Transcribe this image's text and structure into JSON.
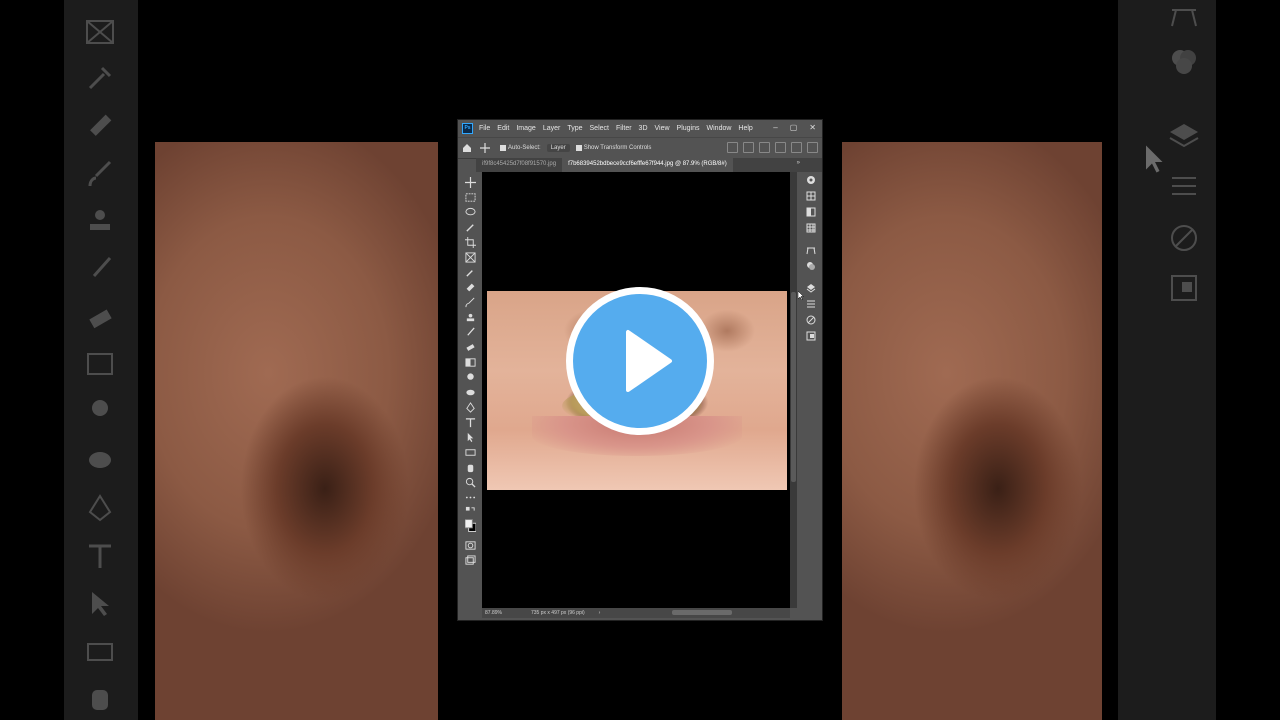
{
  "menu": {
    "app_logo": "Ps",
    "items": [
      "File",
      "Edit",
      "Image",
      "Layer",
      "Type",
      "Select",
      "Filter",
      "3D",
      "View",
      "Plugins",
      "Window",
      "Help"
    ],
    "window_controls": [
      "–",
      "▢",
      "✕"
    ]
  },
  "options": {
    "auto_select_label": "Auto-Select:",
    "auto_select_value": "Layer",
    "show_transform_label": "Show Transform Controls"
  },
  "tabs": [
    {
      "label": "if9f8c45425d7f08f91570.jpg",
      "active": false
    },
    {
      "label": "f7b6839452bdbece9ccf6efffe67f944.jpg @ 87.9% (RGB/8#)",
      "active": true
    }
  ],
  "tabs_more": "»",
  "status": {
    "zoom": "87.89%",
    "dimensions": "735 px x 497 px (96 ppi)",
    "arrow": "›"
  },
  "tools": [
    "move-icon",
    "marquee-icon",
    "lasso-icon",
    "quick-select-icon",
    "crop-icon",
    "frame-icon",
    "eyedropper-icon",
    "healing-icon",
    "brush-icon",
    "stamp-icon",
    "history-brush-icon",
    "eraser-icon",
    "gradient-icon",
    "blur-icon",
    "dodge-icon",
    "pen-icon",
    "type-icon",
    "path-select-icon",
    "rectangle-icon",
    "hand-icon",
    "zoom-icon",
    "more-tools-icon"
  ],
  "colors": {
    "play_button": "#55acee",
    "ps_chrome": "#535353",
    "canvas_bg": "#000000"
  }
}
